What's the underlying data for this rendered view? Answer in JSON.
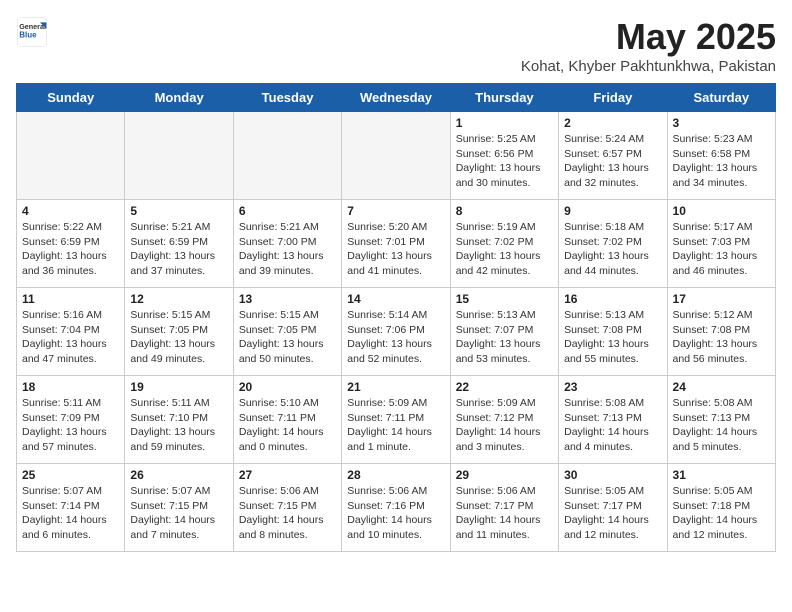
{
  "header": {
    "logo_general": "General",
    "logo_blue": "Blue",
    "month": "May 2025",
    "location": "Kohat, Khyber Pakhtunkhwa, Pakistan"
  },
  "days_of_week": [
    "Sunday",
    "Monday",
    "Tuesday",
    "Wednesday",
    "Thursday",
    "Friday",
    "Saturday"
  ],
  "weeks": [
    [
      {
        "day": "",
        "info": ""
      },
      {
        "day": "",
        "info": ""
      },
      {
        "day": "",
        "info": ""
      },
      {
        "day": "",
        "info": ""
      },
      {
        "day": "1",
        "info": "Sunrise: 5:25 AM\nSunset: 6:56 PM\nDaylight: 13 hours\nand 30 minutes."
      },
      {
        "day": "2",
        "info": "Sunrise: 5:24 AM\nSunset: 6:57 PM\nDaylight: 13 hours\nand 32 minutes."
      },
      {
        "day": "3",
        "info": "Sunrise: 5:23 AM\nSunset: 6:58 PM\nDaylight: 13 hours\nand 34 minutes."
      }
    ],
    [
      {
        "day": "4",
        "info": "Sunrise: 5:22 AM\nSunset: 6:59 PM\nDaylight: 13 hours\nand 36 minutes."
      },
      {
        "day": "5",
        "info": "Sunrise: 5:21 AM\nSunset: 6:59 PM\nDaylight: 13 hours\nand 37 minutes."
      },
      {
        "day": "6",
        "info": "Sunrise: 5:21 AM\nSunset: 7:00 PM\nDaylight: 13 hours\nand 39 minutes."
      },
      {
        "day": "7",
        "info": "Sunrise: 5:20 AM\nSunset: 7:01 PM\nDaylight: 13 hours\nand 41 minutes."
      },
      {
        "day": "8",
        "info": "Sunrise: 5:19 AM\nSunset: 7:02 PM\nDaylight: 13 hours\nand 42 minutes."
      },
      {
        "day": "9",
        "info": "Sunrise: 5:18 AM\nSunset: 7:02 PM\nDaylight: 13 hours\nand 44 minutes."
      },
      {
        "day": "10",
        "info": "Sunrise: 5:17 AM\nSunset: 7:03 PM\nDaylight: 13 hours\nand 46 minutes."
      }
    ],
    [
      {
        "day": "11",
        "info": "Sunrise: 5:16 AM\nSunset: 7:04 PM\nDaylight: 13 hours\nand 47 minutes."
      },
      {
        "day": "12",
        "info": "Sunrise: 5:15 AM\nSunset: 7:05 PM\nDaylight: 13 hours\nand 49 minutes."
      },
      {
        "day": "13",
        "info": "Sunrise: 5:15 AM\nSunset: 7:05 PM\nDaylight: 13 hours\nand 50 minutes."
      },
      {
        "day": "14",
        "info": "Sunrise: 5:14 AM\nSunset: 7:06 PM\nDaylight: 13 hours\nand 52 minutes."
      },
      {
        "day": "15",
        "info": "Sunrise: 5:13 AM\nSunset: 7:07 PM\nDaylight: 13 hours\nand 53 minutes."
      },
      {
        "day": "16",
        "info": "Sunrise: 5:13 AM\nSunset: 7:08 PM\nDaylight: 13 hours\nand 55 minutes."
      },
      {
        "day": "17",
        "info": "Sunrise: 5:12 AM\nSunset: 7:08 PM\nDaylight: 13 hours\nand 56 minutes."
      }
    ],
    [
      {
        "day": "18",
        "info": "Sunrise: 5:11 AM\nSunset: 7:09 PM\nDaylight: 13 hours\nand 57 minutes."
      },
      {
        "day": "19",
        "info": "Sunrise: 5:11 AM\nSunset: 7:10 PM\nDaylight: 13 hours\nand 59 minutes."
      },
      {
        "day": "20",
        "info": "Sunrise: 5:10 AM\nSunset: 7:11 PM\nDaylight: 14 hours\nand 0 minutes."
      },
      {
        "day": "21",
        "info": "Sunrise: 5:09 AM\nSunset: 7:11 PM\nDaylight: 14 hours\nand 1 minute."
      },
      {
        "day": "22",
        "info": "Sunrise: 5:09 AM\nSunset: 7:12 PM\nDaylight: 14 hours\nand 3 minutes."
      },
      {
        "day": "23",
        "info": "Sunrise: 5:08 AM\nSunset: 7:13 PM\nDaylight: 14 hours\nand 4 minutes."
      },
      {
        "day": "24",
        "info": "Sunrise: 5:08 AM\nSunset: 7:13 PM\nDaylight: 14 hours\nand 5 minutes."
      }
    ],
    [
      {
        "day": "25",
        "info": "Sunrise: 5:07 AM\nSunset: 7:14 PM\nDaylight: 14 hours\nand 6 minutes."
      },
      {
        "day": "26",
        "info": "Sunrise: 5:07 AM\nSunset: 7:15 PM\nDaylight: 14 hours\nand 7 minutes."
      },
      {
        "day": "27",
        "info": "Sunrise: 5:06 AM\nSunset: 7:15 PM\nDaylight: 14 hours\nand 8 minutes."
      },
      {
        "day": "28",
        "info": "Sunrise: 5:06 AM\nSunset: 7:16 PM\nDaylight: 14 hours\nand 10 minutes."
      },
      {
        "day": "29",
        "info": "Sunrise: 5:06 AM\nSunset: 7:17 PM\nDaylight: 14 hours\nand 11 minutes."
      },
      {
        "day": "30",
        "info": "Sunrise: 5:05 AM\nSunset: 7:17 PM\nDaylight: 14 hours\nand 12 minutes."
      },
      {
        "day": "31",
        "info": "Sunrise: 5:05 AM\nSunset: 7:18 PM\nDaylight: 14 hours\nand 12 minutes."
      }
    ]
  ]
}
